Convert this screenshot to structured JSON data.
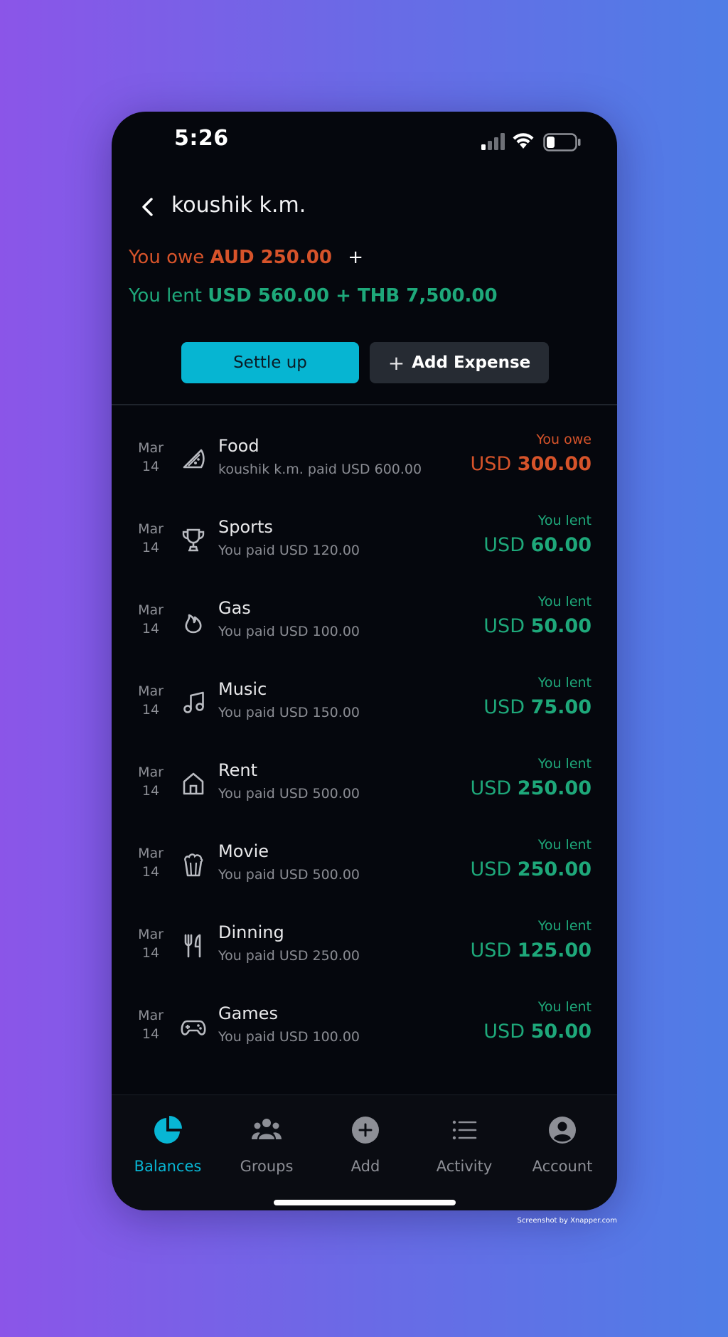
{
  "status_bar": {
    "time": "5:26"
  },
  "header": {
    "contact_name": "koushik k.m.",
    "owe_prefix": "You owe",
    "owe_amount": "AUD 250.00",
    "owe_plus": "+",
    "lent_prefix": "You lent",
    "lent_amount": "USD 560.00 + THB 7,500.00"
  },
  "actions": {
    "settle_label": "Settle up",
    "add_expense_label": "Add Expense"
  },
  "expenses": [
    {
      "month": "Mar",
      "day": "14",
      "icon": "pizza-icon",
      "name": "Food",
      "detail": "koushik k.m. paid USD 600.00",
      "status": "You owe",
      "currency": "USD",
      "amount": "300.00",
      "kind": "owe"
    },
    {
      "month": "Mar",
      "day": "14",
      "icon": "trophy-icon",
      "name": "Sports",
      "detail": "You paid USD 120.00",
      "status": "You lent",
      "currency": "USD",
      "amount": "60.00",
      "kind": "lent"
    },
    {
      "month": "Mar",
      "day": "14",
      "icon": "flame-icon",
      "name": "Gas",
      "detail": "You paid USD 100.00",
      "status": "You lent",
      "currency": "USD",
      "amount": "50.00",
      "kind": "lent"
    },
    {
      "month": "Mar",
      "day": "14",
      "icon": "music-note-icon",
      "name": "Music",
      "detail": "You paid USD 150.00",
      "status": "You lent",
      "currency": "USD",
      "amount": "75.00",
      "kind": "lent"
    },
    {
      "month": "Mar",
      "day": "14",
      "icon": "house-icon",
      "name": "Rent",
      "detail": "You paid USD 500.00",
      "status": "You lent",
      "currency": "USD",
      "amount": "250.00",
      "kind": "lent"
    },
    {
      "month": "Mar",
      "day": "14",
      "icon": "popcorn-icon",
      "name": "Movie",
      "detail": "You paid USD 500.00",
      "status": "You lent",
      "currency": "USD",
      "amount": "250.00",
      "kind": "lent"
    },
    {
      "month": "Mar",
      "day": "14",
      "icon": "fork-knife-icon",
      "name": "Dinning",
      "detail": "You paid USD 250.00",
      "status": "You lent",
      "currency": "USD",
      "amount": "125.00",
      "kind": "lent"
    },
    {
      "month": "Mar",
      "day": "14",
      "icon": "gamepad-icon",
      "name": "Games",
      "detail": "You paid USD 100.00",
      "status": "You lent",
      "currency": "USD",
      "amount": "50.00",
      "kind": "lent"
    }
  ],
  "tabs": [
    {
      "label": "Balances",
      "icon": "pie-chart-icon",
      "active": true
    },
    {
      "label": "Groups",
      "icon": "group-icon",
      "active": false
    },
    {
      "label": "Add",
      "icon": "plus-circle-icon",
      "active": false
    },
    {
      "label": "Activity",
      "icon": "list-icon",
      "active": false
    },
    {
      "label": "Account",
      "icon": "user-circle-icon",
      "active": false
    }
  ],
  "colors": {
    "owe": "#d6532a",
    "lent": "#1ea87a",
    "accent": "#06b5d2",
    "background": "#05070d"
  },
  "credit": "Screenshot by Xnapper.com"
}
